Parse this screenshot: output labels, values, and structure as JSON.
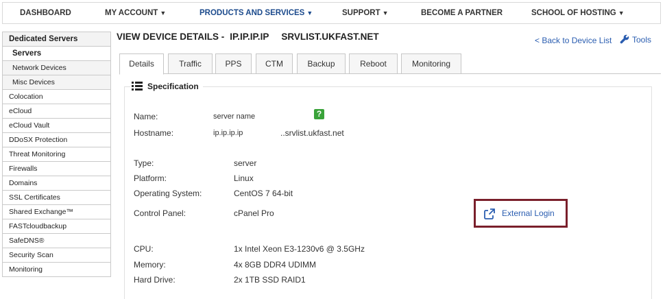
{
  "topnav": {
    "items": [
      {
        "label": "DASHBOARD",
        "caret": ""
      },
      {
        "label": "MY ACCOUNT",
        "caret": "▼"
      },
      {
        "label": "PRODUCTS AND SERVICES",
        "caret": "▼"
      },
      {
        "label": "SUPPORT",
        "caret": "▼"
      },
      {
        "label": "BECOME A PARTNER",
        "caret": ""
      },
      {
        "label": "SCHOOL OF HOSTING",
        "caret": "▼"
      }
    ]
  },
  "sidebar": {
    "items": [
      "Dedicated Servers",
      "Servers",
      "Network Devices",
      "Misc Devices",
      "Colocation",
      "eCloud",
      "eCloud Vault",
      "DDoSX Protection",
      "Threat Monitoring",
      "Firewalls",
      "Domains",
      "SSL Certificates",
      "Shared Exchange™",
      "FASTcloudbackup",
      "SafeDNS®",
      "Security Scan",
      "Monitoring"
    ]
  },
  "header": {
    "title": "VIEW DEVICE DETAILS -",
    "ip": "IP.IP.IP.IP",
    "host": "SRVLIST.UKFAST.NET",
    "back_link": "< Back to Device List",
    "tools_link": "Tools"
  },
  "tabs": [
    "Details",
    "Traffic",
    "PPS",
    "CTM",
    "Backup",
    "Reboot",
    "Monitoring"
  ],
  "spec": {
    "heading": "Specification",
    "name_label": "Name:",
    "name_value": "server name",
    "hostname_label": "Hostname:",
    "hostname_ip": "ip.ip.ip.ip",
    "hostname_value": "..srvlist.ukfast.net",
    "type_label": "Type:",
    "type_value": "server",
    "platform_label": "Platform:",
    "platform_value": "Linux",
    "os_label": "Operating System:",
    "os_value": "CentOS 7 64-bit",
    "cp_label": "Control Panel:",
    "cp_value": "cPanel Pro",
    "external_login": "External Login",
    "cpu_label": "CPU:",
    "cpu_value": "1x Intel Xeon E3-1230v6 @ 3.5GHz",
    "memory_label": "Memory:",
    "memory_value": "4x 8GB DDR4 UDIMM",
    "drive_label": "Hard Drive:",
    "drive_value": "2x 1TB SSD RAID1"
  },
  "colors": {
    "link": "#2a5db0",
    "highlight_border": "#7a1f2b",
    "help_green": "#3aa33a",
    "nav_active": "#1b4a8c"
  },
  "icons": [
    "list-icon",
    "wrench-icon",
    "help-icon",
    "external-link-icon"
  ]
}
